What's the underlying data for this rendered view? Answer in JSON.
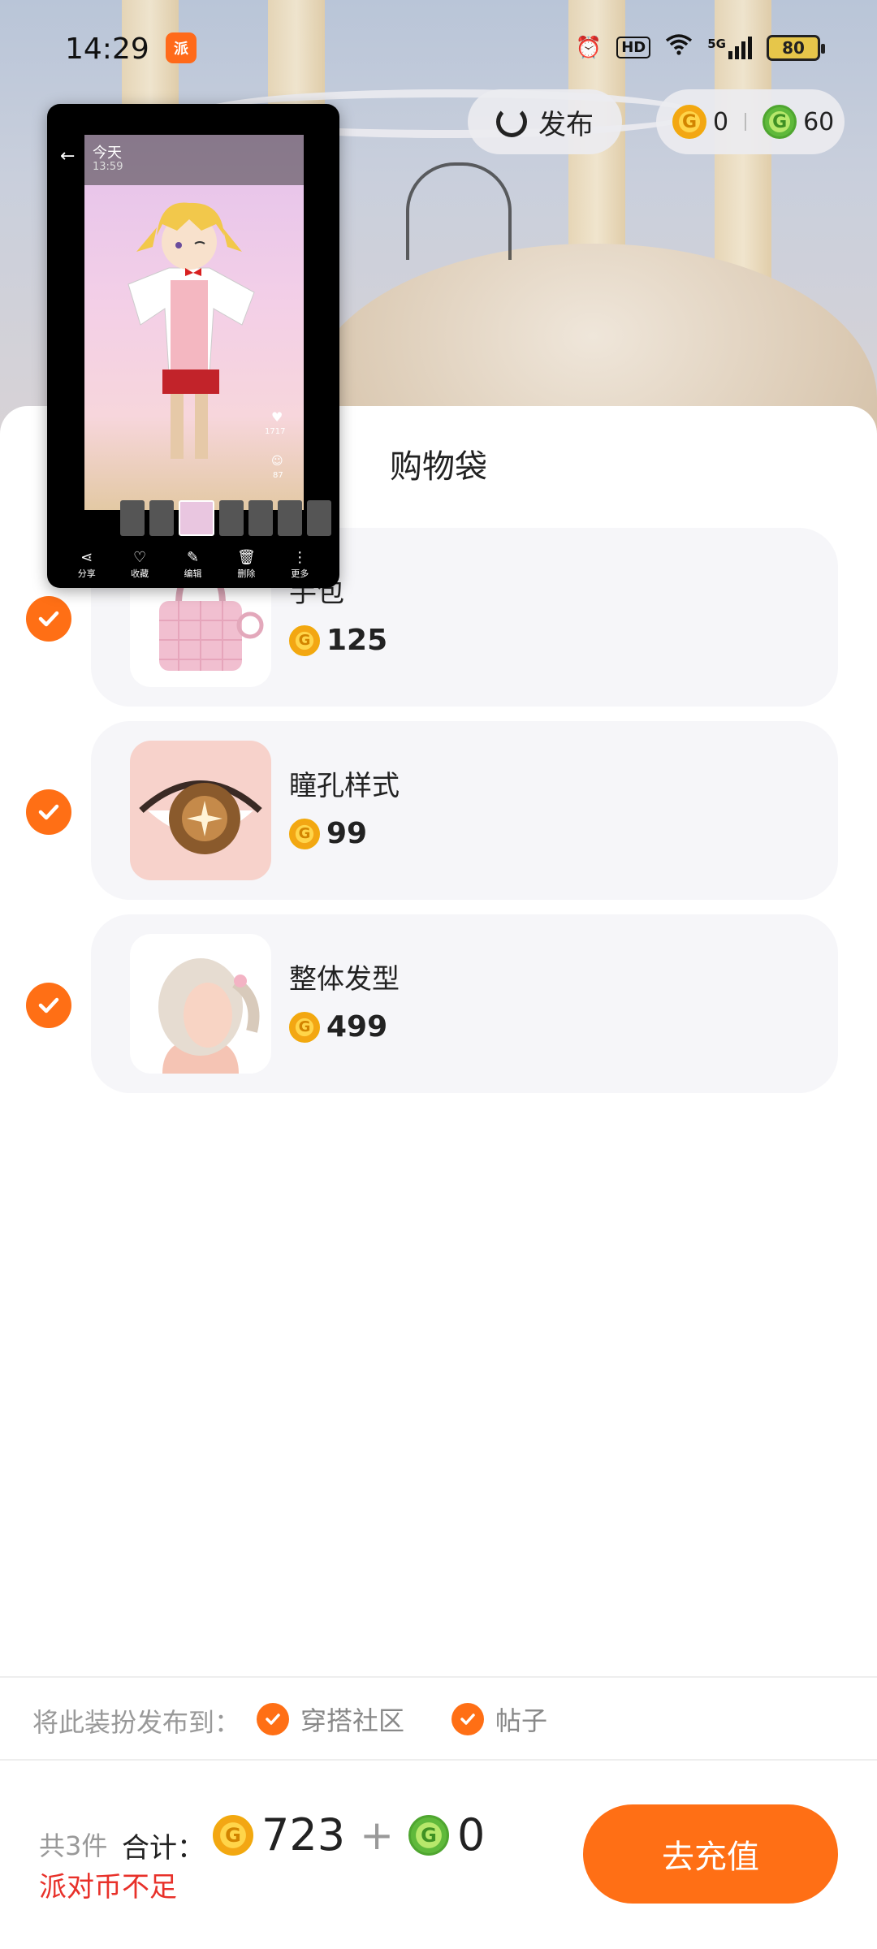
{
  "status_bar": {
    "time": "14:29",
    "app_badge": "派",
    "hd": "HD",
    "network": "5G",
    "battery": "80"
  },
  "top": {
    "publish_label": "发布",
    "gold_balance": "0",
    "green_balance": "60"
  },
  "sheet": {
    "title": "购物袋",
    "items": [
      {
        "name": "手包",
        "price": "125"
      },
      {
        "name": "瞳孔样式",
        "price": "99"
      },
      {
        "name": "整体发型",
        "price": "499"
      }
    ]
  },
  "publish_to": {
    "label": "将此装扮发布到：",
    "targets": [
      "穿搭社区",
      "帖子"
    ]
  },
  "footer": {
    "count": "共3件",
    "total_label": "合计：",
    "gold_total": "723",
    "green_total": "0",
    "warning": "派对币不足",
    "recharge_label": "去充值"
  },
  "preview": {
    "title": "今天",
    "time": "13:59",
    "like_count": "1717",
    "comment_count": "87",
    "actions": [
      "分享",
      "收藏",
      "编辑",
      "删除",
      "更多"
    ]
  },
  "colors": {
    "accent": "#ff6f15",
    "warning": "#e8312a",
    "card_bg": "#f6f6f9"
  }
}
